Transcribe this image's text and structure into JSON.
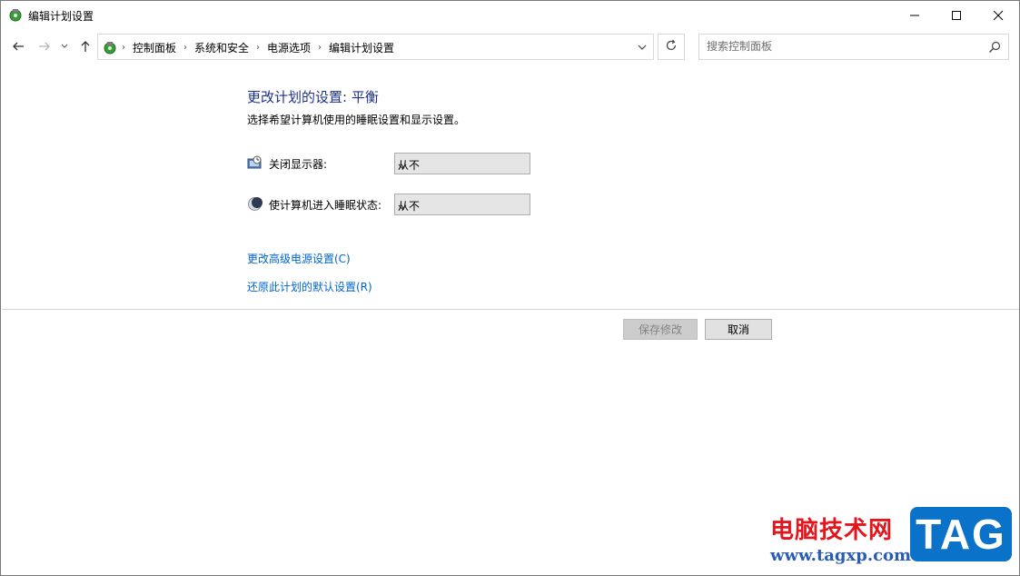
{
  "window": {
    "title": "编辑计划设置",
    "controls": {
      "minimize": "minimize-icon",
      "maximize": "maximize-icon",
      "close": "close-icon"
    }
  },
  "nav": {
    "breadcrumbs": [
      "控制面板",
      "系统和安全",
      "电源选项",
      "编辑计划设置"
    ],
    "search_placeholder": "搜索控制面板"
  },
  "main": {
    "heading": "更改计划的设置: 平衡",
    "subtitle": "选择希望计算机使用的睡眠设置和显示设置。",
    "settings": [
      {
        "label": "关闭显示器:",
        "value": "从不",
        "icon": "monitor-clock-icon"
      },
      {
        "label": "使计算机进入睡眠状态:",
        "value": "从不",
        "icon": "moon-sleep-icon"
      }
    ],
    "links": {
      "advanced": "更改高级电源设置(C)",
      "restore": "还原此计划的默认设置(R)"
    },
    "buttons": {
      "save": "保存修改",
      "cancel": "取消"
    }
  },
  "watermark": {
    "text": "电脑技术网",
    "url": "www.tagxp.com",
    "badge": "TAG"
  },
  "colors": {
    "heading": "#1e3287",
    "link": "#0066cc",
    "watermark_red": "#e3161d",
    "watermark_blue": "#0a72c9"
  }
}
